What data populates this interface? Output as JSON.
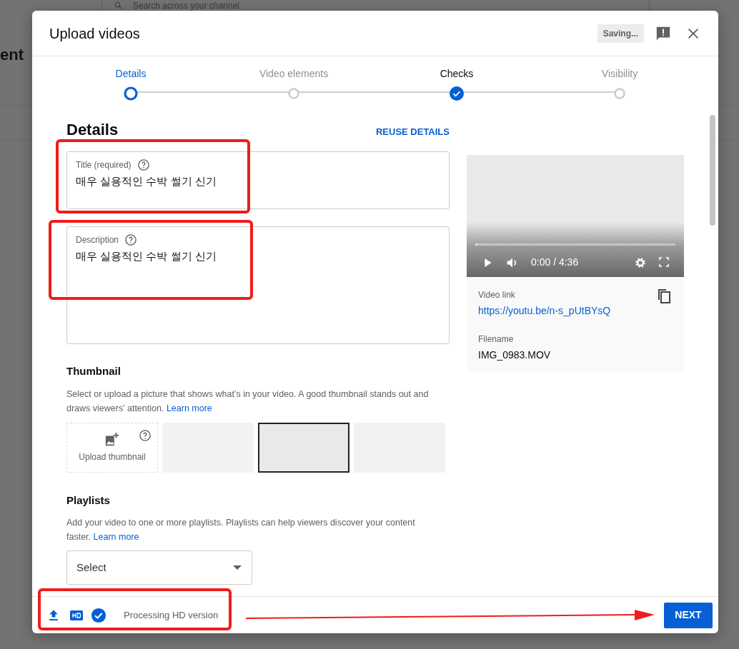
{
  "background": {
    "search_placeholder": "Search across your channel",
    "heading_fragment": "ent"
  },
  "dialog": {
    "title": "Upload videos",
    "saving_badge": "Saving..."
  },
  "steps": [
    {
      "label": "Details",
      "selected": true,
      "completed": false
    },
    {
      "label": "Video elements",
      "selected": false,
      "completed": false
    },
    {
      "label": "Checks",
      "selected": false,
      "completed": true
    },
    {
      "label": "Visibility",
      "selected": false,
      "completed": false
    }
  ],
  "details": {
    "heading": "Details",
    "reuse_button": "REUSE DETAILS",
    "title_field": {
      "label": "Title (required)",
      "value": "매우 실용적인 수박 썰기 신기"
    },
    "description_field": {
      "label": "Description",
      "value": "매우 실용적인 수박 썰기 신기"
    }
  },
  "thumbnail": {
    "heading": "Thumbnail",
    "text": "Select or upload a picture that shows what’s in your video. A good thumbnail stands out and draws viewers’ attention.",
    "link": "Learn more",
    "upload_label": "Upload thumbnail",
    "options": [
      {
        "selected": false
      },
      {
        "selected": true
      },
      {
        "selected": false
      }
    ]
  },
  "playlists": {
    "heading": "Playlists",
    "text": "Add your video to one or more playlists. Playlists can help viewers discover your content faster.",
    "link": "Learn more",
    "select_placeholder": "Select"
  },
  "video": {
    "time": "0:00 / 4:36",
    "level": 0.01,
    "link_label": "Video link",
    "link": "https://youtu.be/n-s_pUtBYsQ",
    "filename_label": "Filename",
    "filename": "IMG_0983.MOV"
  },
  "footer": {
    "status": "Processing HD version",
    "next_button": "NEXT"
  }
}
